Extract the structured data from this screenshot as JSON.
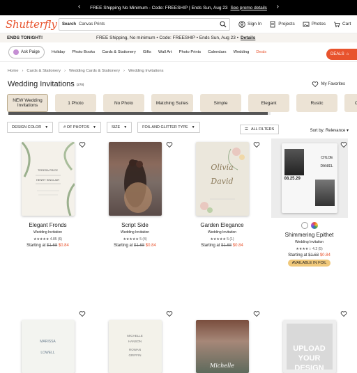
{
  "promo": {
    "text": "FREE Shipping No Minimum - Code: FREESHIP | Ends Sun, Aug 23",
    "link": "See promo details"
  },
  "header": {
    "logo": "Shutterfly",
    "search_label": "Search",
    "search_value": "Canvas Prints",
    "links": [
      "Sign In",
      "Projects",
      "Photos",
      "Cart"
    ]
  },
  "ends": {
    "label": "ENDS TONIGHT!",
    "message": "FREE Shipping, No minimum  •  Code: FREESHIP  •  Ends Sun, Aug 23  •",
    "details": "Details"
  },
  "nav": {
    "ask": "Ask Paige",
    "items": [
      "Holiday",
      "Photo Books",
      "Cards & Stationery",
      "Gifts",
      "Wall Art",
      "Photo Prints",
      "Calendars",
      "Wedding"
    ],
    "deals": "Deals",
    "deals_button": "DEALS"
  },
  "breadcrumb": [
    "Home",
    "Cards & Stationery",
    "Wedding Cards & Stationery",
    "Wedding Invitations"
  ],
  "page": {
    "title": "Wedding Invitations",
    "count": "(270)",
    "favorites": "My Favorites"
  },
  "chips": [
    "NEW Wedding Invitations",
    "1 Photo",
    "No Photo",
    "Matching Suites",
    "Simple",
    "Elegant",
    "Rustic",
    "Classic"
  ],
  "filters": {
    "items": [
      "DESIGN COLOR",
      "# OF PHOTOS",
      "SIZE",
      "FOIL AND GLITTER TYPE"
    ],
    "all": "ALL FILTERS",
    "sort_label": "Sort by:",
    "sort_value": "Relevance"
  },
  "products": [
    {
      "name": "Elegant Fronds",
      "type": "Wedding Invitation",
      "rating": "4.85",
      "reviews": "(6)",
      "starting": "Starting at",
      "old": "$1.68",
      "new": "$0.84"
    },
    {
      "name": "Script Side",
      "type": "Wedding Invitation",
      "rating": "5",
      "reviews": "(4)",
      "starting": "Starting at",
      "old": "$1.68",
      "new": "$0.84"
    },
    {
      "name": "Garden Elegance",
      "type": "Wedding Invitation",
      "rating": "5",
      "reviews": "(1)",
      "starting": "Starting at",
      "old": "$1.68",
      "new": "$0.84"
    },
    {
      "name": "Shimmering Epithet",
      "type": "Wedding Invitation",
      "rating": "4.2",
      "reviews": "(5)",
      "starting": "Starting at",
      "old": "$1.68",
      "new": "$0.84",
      "badge": "AVAILABLE IN FOIL"
    }
  ],
  "card_text": {
    "c1": [
      "TERESA PRICE",
      "HENRY SINCLAIR"
    ],
    "c3": [
      "Olivia",
      "David"
    ],
    "c4": [
      "08.25.29",
      "CHLOE",
      "DANIEL"
    ],
    "r2_1": [
      "MARISSA",
      "LOWELL"
    ],
    "r2_2": [
      "MICHELLE",
      "HANSON",
      "ROWAN",
      "GRIFFIN"
    ],
    "r2_3": [
      "Michelle"
    ],
    "r2_4": [
      "UPLOAD",
      "YOUR",
      "DESIGN"
    ]
  }
}
